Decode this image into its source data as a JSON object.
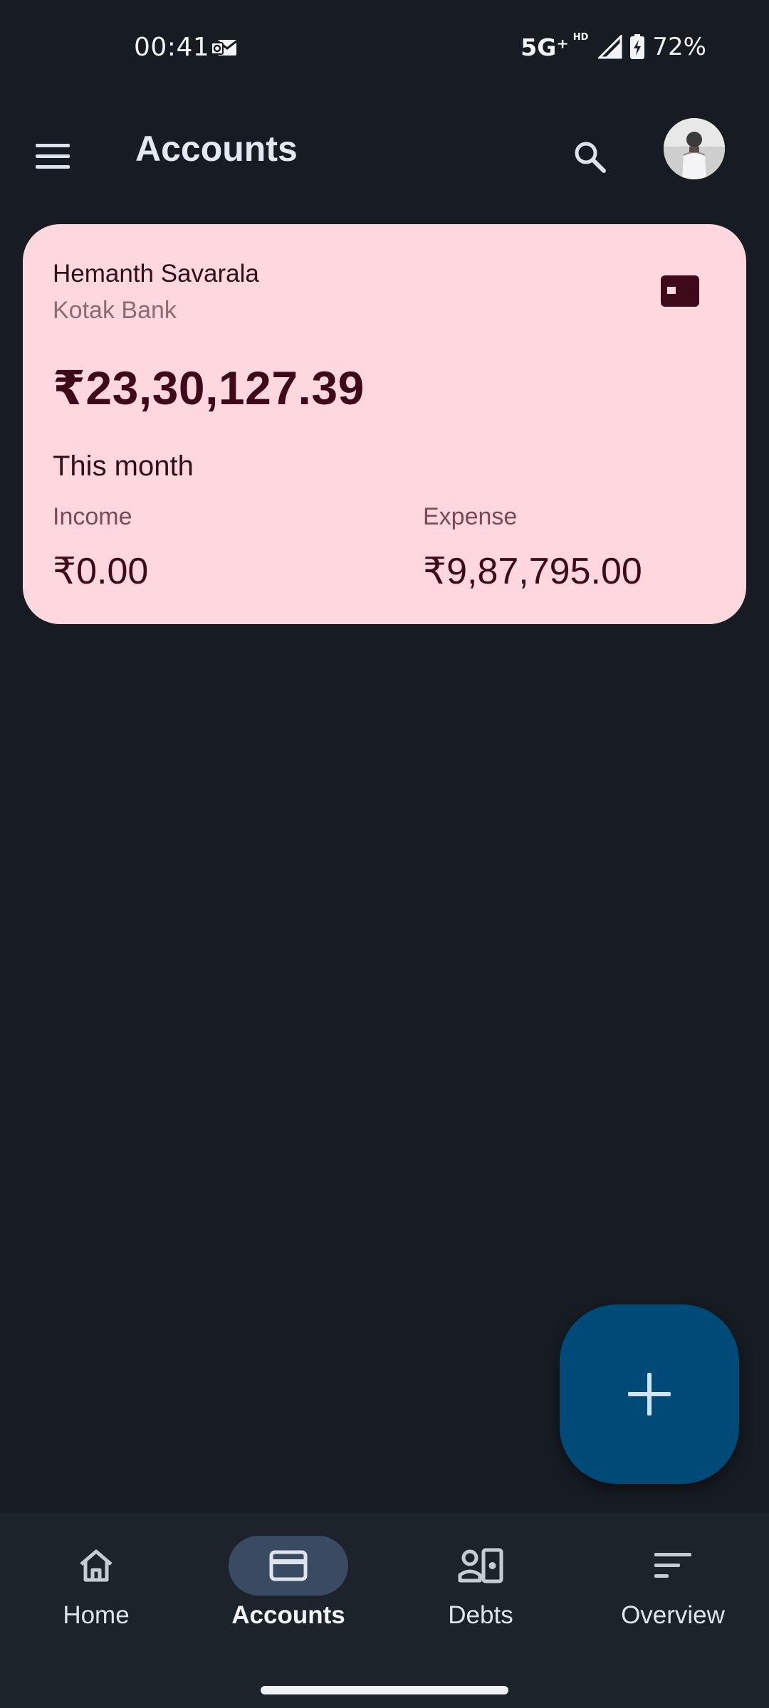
{
  "status_bar": {
    "time": "00:41",
    "network": "5G⁺",
    "hd": "HD",
    "battery": "72%"
  },
  "header": {
    "title": "Accounts"
  },
  "account": {
    "holder": "Hemanth Savarala",
    "bank": "Kotak Bank",
    "balance": "₹23,30,127.39",
    "period_label": "This month",
    "income_label": "Income",
    "income_value": "₹0.00",
    "expense_label": "Expense",
    "expense_value": "₹9,87,795.00"
  },
  "nav": {
    "home": "Home",
    "accounts": "Accounts",
    "debts": "Debts",
    "overview": "Overview"
  },
  "colors": {
    "background": "#171c23",
    "card": "#ffd8df",
    "fab": "#004a78",
    "nav_active": "#3a4a63"
  }
}
